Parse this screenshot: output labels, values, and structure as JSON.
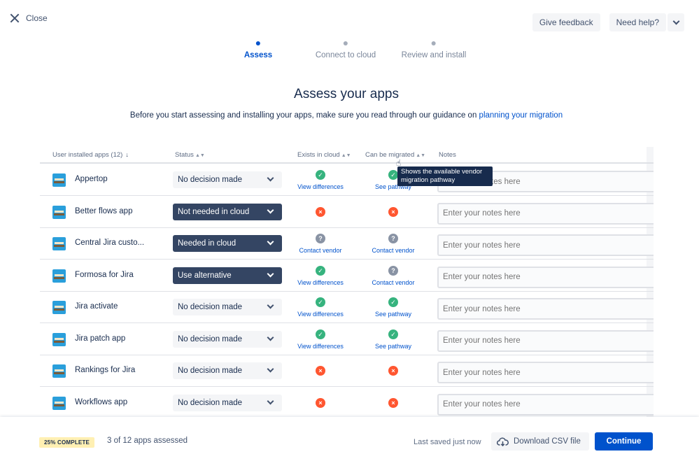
{
  "header": {
    "close_label": "Close",
    "feedback_label": "Give feedback",
    "help_label": "Need help?"
  },
  "steps": [
    {
      "label": "Assess",
      "active": true
    },
    {
      "label": "Connect to cloud",
      "active": false
    },
    {
      "label": "Review and install",
      "active": false
    }
  ],
  "title": "Assess your apps",
  "intro": {
    "text": "Before you start assessing and installing your apps, make sure you read through our guidance on ",
    "link": "planning your migration"
  },
  "table": {
    "headers": {
      "apps": "User installed apps (12)",
      "status": "Status",
      "exists": "Exists in cloud",
      "migrated": "Can be migrated",
      "notes": "Notes"
    },
    "notes_placeholder": "Enter your notes here",
    "rows": [
      {
        "name": "Appertop",
        "status": "No decision made",
        "status_style": "light",
        "exists_icon": "check",
        "exists_link": "View differences",
        "migrated_icon": "check",
        "migrated_link": "See pathway"
      },
      {
        "name": "Better flows app",
        "status": "Not needed in cloud",
        "status_style": "dark",
        "exists_icon": "cross",
        "exists_link": "",
        "migrated_icon": "cross",
        "migrated_link": ""
      },
      {
        "name": "Central Jira custo...",
        "status": "Needed in cloud",
        "status_style": "dark",
        "exists_icon": "help",
        "exists_link": "Contact vendor",
        "migrated_icon": "help",
        "migrated_link": "Contact vendor"
      },
      {
        "name": "Formosa for Jira",
        "status": "Use alternative",
        "status_style": "dark",
        "exists_icon": "check",
        "exists_link": "View differences",
        "migrated_icon": "help",
        "migrated_link": "Contact vendor"
      },
      {
        "name": "Jira activate",
        "status": "No decision made",
        "status_style": "light",
        "exists_icon": "check",
        "exists_link": "View differences",
        "migrated_icon": "check",
        "migrated_link": "See pathway"
      },
      {
        "name": "Jira patch app",
        "status": "No decision made",
        "status_style": "light",
        "exists_icon": "check",
        "exists_link": "View differences",
        "migrated_icon": "check",
        "migrated_link": "See pathway"
      },
      {
        "name": "Rankings for Jira",
        "status": "No decision made",
        "status_style": "light",
        "exists_icon": "cross",
        "exists_link": "",
        "migrated_icon": "cross",
        "migrated_link": ""
      },
      {
        "name": "Workflows app",
        "status": "No decision made",
        "status_style": "light",
        "exists_icon": "cross",
        "exists_link": "",
        "migrated_icon": "cross",
        "migrated_link": ""
      }
    ]
  },
  "tooltip": "Shows the available vendor migration pathway",
  "footer": {
    "badge": "25% COMPLETE",
    "progress_text": "3 of 12 apps assessed",
    "saved_text": "Last saved just now",
    "csv_label": "Download CSV file",
    "continue_label": "Continue"
  },
  "colors": {
    "accent": "#0052CC",
    "success": "#36B37E",
    "error": "#FF5630",
    "neutral": "#8993A4",
    "dark_select": "#344563"
  }
}
